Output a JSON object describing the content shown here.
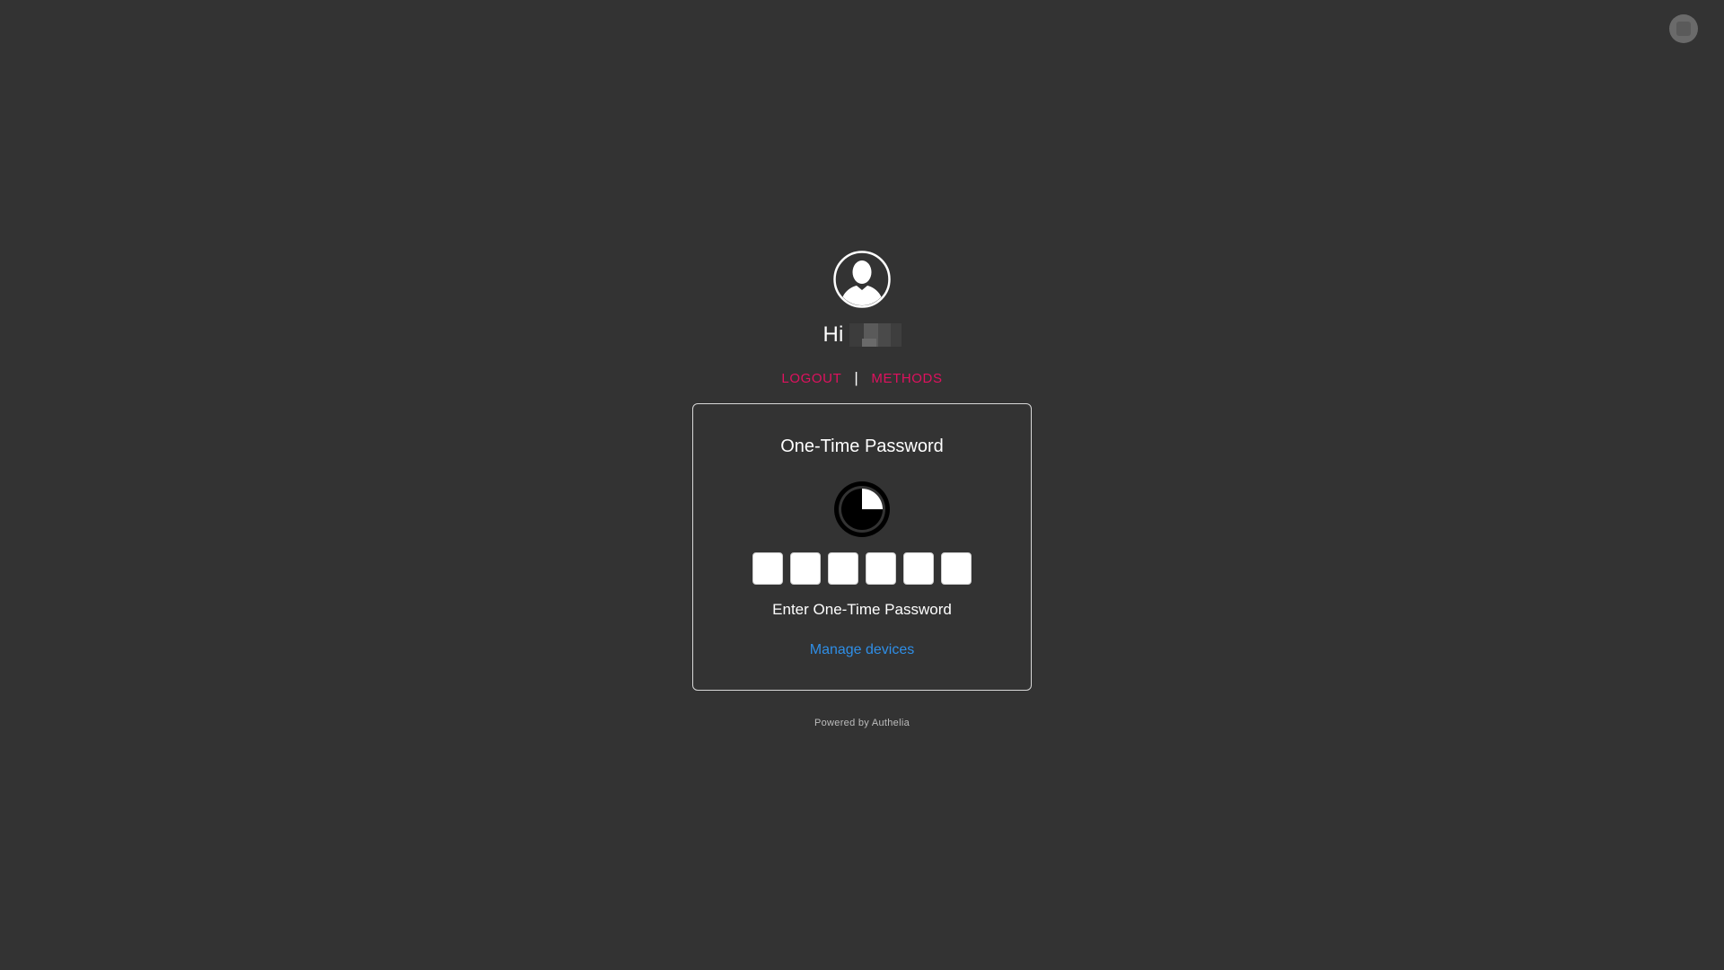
{
  "header": {
    "corner_button_icon": "settings-icon"
  },
  "user": {
    "greeting": "Hi",
    "username": "",
    "avatar_icon": "user-avatar-icon"
  },
  "nav": {
    "logout_label": "LOGOUT",
    "separator": "|",
    "methods_label": "METHODS"
  },
  "otp_card": {
    "title": "One-Time Password",
    "timer_icon": "countdown-timer-icon",
    "timer_progress": 0.25,
    "digits": [
      "",
      "",
      "",
      "",
      "",
      ""
    ],
    "hint": "Enter One-Time Password",
    "manage_link": "Manage devices"
  },
  "footer": {
    "powered_by": "Powered by Authelia"
  },
  "colors": {
    "background": "#333333",
    "accent_link": "#e0115f",
    "manage_link": "#2f8ee6",
    "text": "#ffffff"
  }
}
